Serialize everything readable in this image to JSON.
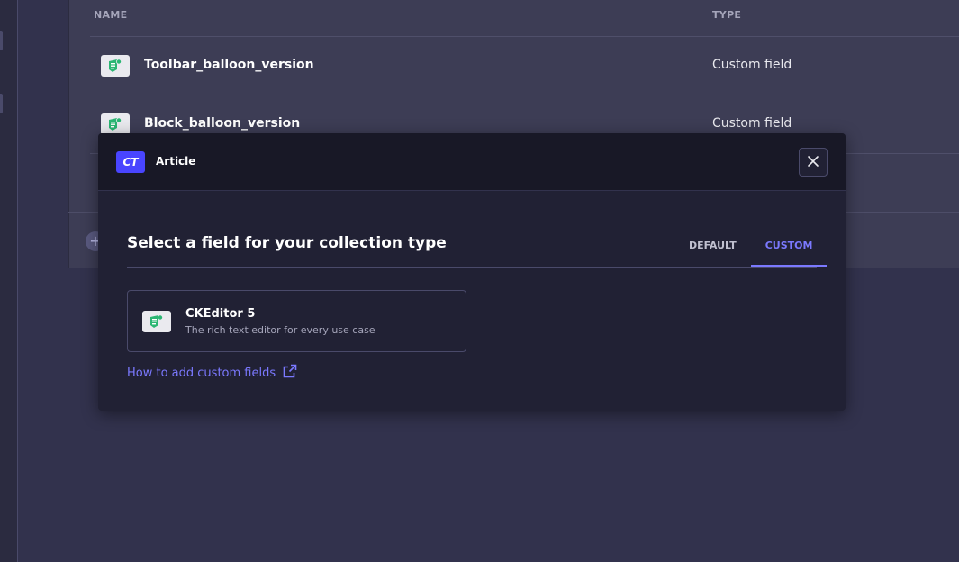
{
  "background_table": {
    "columns": {
      "name": "NAME",
      "type": "TYPE"
    },
    "rows": [
      {
        "name": "Toolbar_balloon_version",
        "type": "Custom field",
        "icon": "ckeditor-icon"
      },
      {
        "name": "Block_balloon_version",
        "type": "Custom field",
        "icon": "ckeditor-icon"
      }
    ],
    "add_icon": "plus-icon"
  },
  "modal": {
    "header": {
      "badge": "CT",
      "title": "Article",
      "close_icon": "close-icon"
    },
    "title": "Select a field for your collection type",
    "tabs": [
      {
        "label": "DEFAULT",
        "active": false
      },
      {
        "label": "CUSTOM",
        "active": true
      }
    ],
    "fields": [
      {
        "title": "CKEditor 5",
        "description": "The rich text editor for every use case",
        "icon": "ckeditor-icon"
      }
    ],
    "help_link": {
      "label": "How to add custom fields",
      "icon": "external-link-icon"
    }
  },
  "colors": {
    "accent": "#7b79ff",
    "badge": "#4945ff",
    "icon_green": "#2bb673",
    "modal_bg": "#212134",
    "header_bg": "#181826"
  }
}
